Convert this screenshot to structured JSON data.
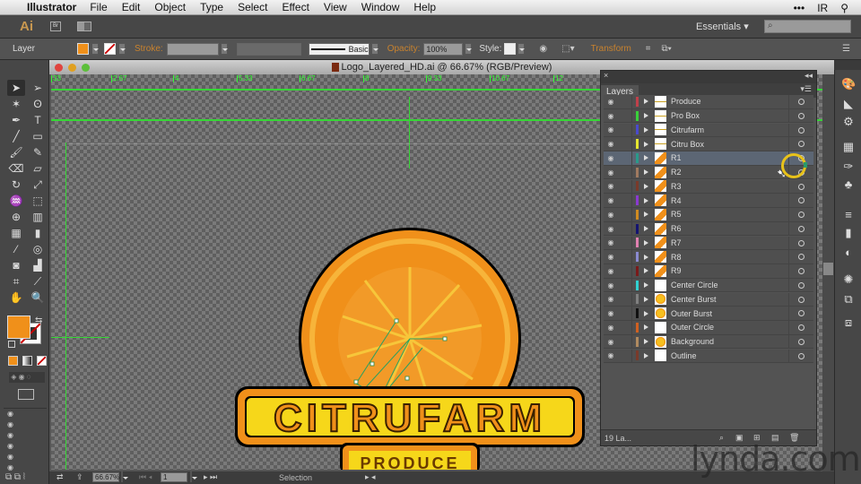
{
  "menubar": {
    "apple_icon": "apple-icon",
    "app_name": "Illustrator",
    "items": [
      "File",
      "Edit",
      "Object",
      "Type",
      "Select",
      "Effect",
      "View",
      "Window",
      "Help"
    ],
    "right": {
      "dots": "•••",
      "initials": "IR",
      "search_icon": "magnifier-icon"
    }
  },
  "appbar": {
    "logo": "Ai",
    "bridge": "Br",
    "workspace": "Essentials",
    "search_placeholder": "⌕"
  },
  "control": {
    "selection_label": "Layer",
    "fill_color": "#f0901a",
    "stroke_label": "Stroke:",
    "brush": "Basic",
    "opacity_label": "Opacity:",
    "opacity_value": "100%",
    "style_label": "Style:",
    "transform_label": "Transform"
  },
  "document": {
    "title": "Logo_Layered_HD.ai @ 66.67% (RGB/Preview)",
    "ruler_labels": [
      "33",
      "2.67",
      "4",
      "5.33",
      "6.67",
      "8",
      "9.33",
      "10.67",
      "12"
    ]
  },
  "status": {
    "zoom": "66.67%",
    "artboard": "1",
    "tool": "Selection"
  },
  "tools": {
    "fill_color": "#f0901a",
    "stroke_color": "#ffffff"
  },
  "artwork": {
    "brand": "CITRUFARM",
    "tagline": "PRODUCE"
  },
  "layers": {
    "tab": "Layers",
    "count": "19 La...",
    "items": [
      {
        "name": "Produce",
        "color": "#c0404a"
      },
      {
        "name": "Pro Box",
        "color": "#3ad03a"
      },
      {
        "name": "Citrufarm",
        "color": "#4a4acc"
      },
      {
        "name": "Citru Box",
        "color": "#e6e630"
      },
      {
        "name": "R1",
        "color": "#2a9a8a",
        "selected": true
      },
      {
        "name": "R2",
        "color": "#a07a60"
      },
      {
        "name": "R3",
        "color": "#7a3a2a"
      },
      {
        "name": "R4",
        "color": "#8a3ad0"
      },
      {
        "name": "R5",
        "color": "#d08a20"
      },
      {
        "name": "R6",
        "color": "#141470"
      },
      {
        "name": "R7",
        "color": "#e080b0"
      },
      {
        "name": "R8",
        "color": "#8a8ad0"
      },
      {
        "name": "R9",
        "color": "#7a1a1a"
      },
      {
        "name": "Center Circle",
        "color": "#30d0d0"
      },
      {
        "name": "Center Burst",
        "color": "#808080"
      },
      {
        "name": "Outer Burst",
        "color": "#111111"
      },
      {
        "name": "Outer Circle",
        "color": "#d06020"
      },
      {
        "name": "Background",
        "color": "#b08a60"
      },
      {
        "name": "Outline",
        "color": "#7a3a2a"
      }
    ]
  },
  "watermark": "lynda.com"
}
